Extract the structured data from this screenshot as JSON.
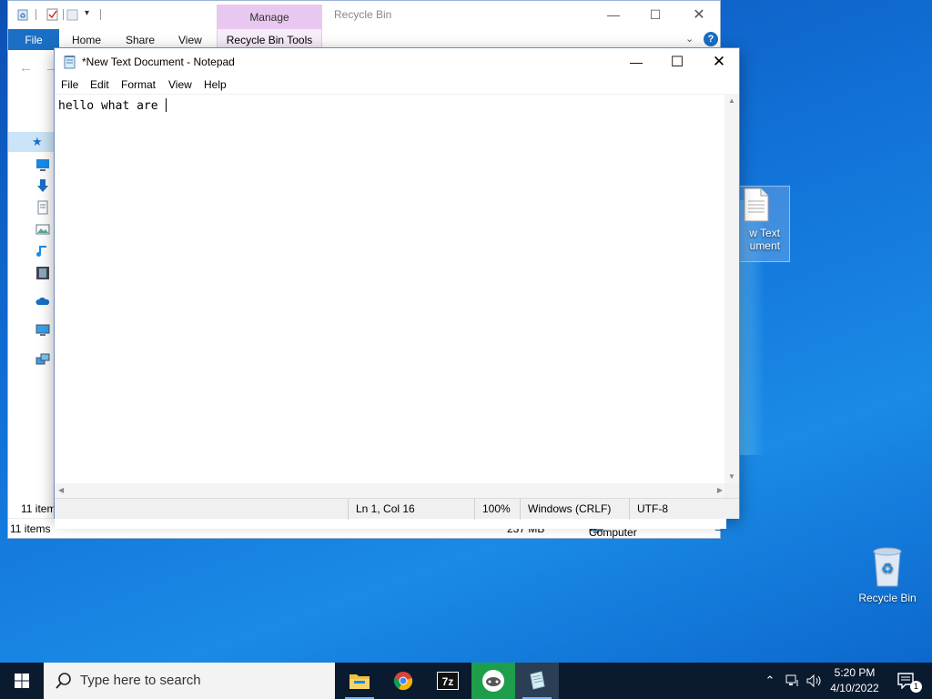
{
  "explorer": {
    "title": "Recycle Bin",
    "manage_label": "Manage",
    "tools_label": "Recycle Bin Tools",
    "file_tab": "File",
    "tabs": [
      "Home",
      "Share",
      "View"
    ],
    "help": "?",
    "items_count_top": "11 item",
    "items_count": "11 items",
    "size": "237 MB",
    "location": "Computer"
  },
  "notepad": {
    "title": "*New Text Document - Notepad",
    "menu": [
      "File",
      "Edit",
      "Format",
      "View",
      "Help"
    ],
    "content": "hello what are ",
    "status": {
      "position": "Ln 1, Col 16",
      "zoom": "100%",
      "line_ending": "Windows (CRLF)",
      "encoding": "UTF-8"
    }
  },
  "desktop": {
    "new_doc_label_1": "w Text",
    "new_doc_label_2": "ument",
    "recycle_label": "Recycle Bin"
  },
  "taskbar": {
    "search_placeholder": "Type here to search",
    "time": "5:20 PM",
    "date": "4/10/2022",
    "notification_count": "1"
  },
  "colors": {
    "accent": "#1a6fc4",
    "manage_tab": "#e8c8f0",
    "taskbar": "#0a1a2f"
  }
}
